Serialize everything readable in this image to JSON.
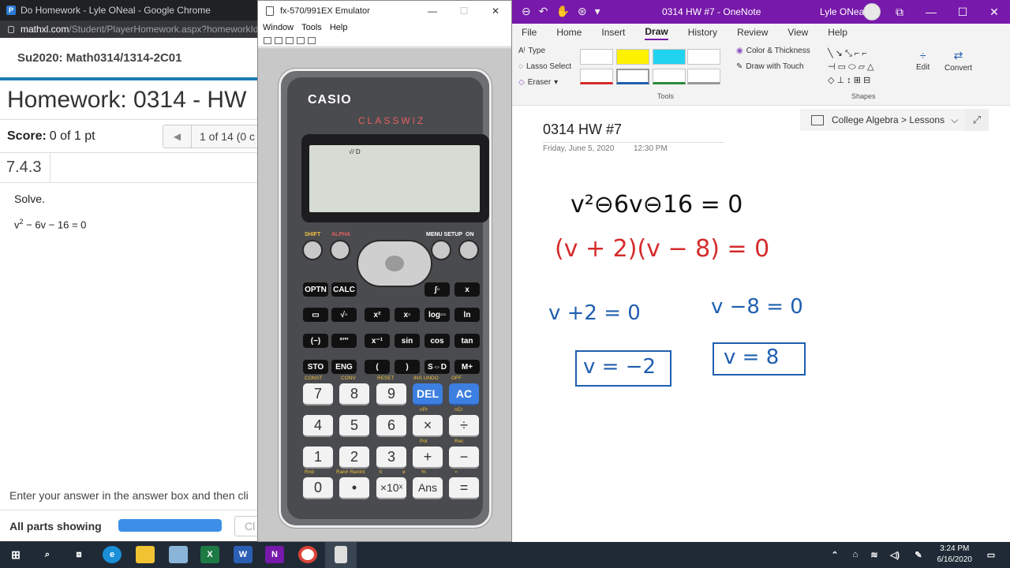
{
  "chrome": {
    "title": "Do Homework - Lyle ONeal - Google Chrome",
    "url_host": "mathxl.com",
    "url_path": "/Student/PlayerHomework.aspx?homeworkId",
    "course": "Su2020: Math0314/1314-2C01",
    "homework_title": "Homework: 0314 - HW",
    "score_label": "Score:",
    "score_value": "0 of 1 pt",
    "pager": "1 of 14 (0 c",
    "question_number": "7.4.3",
    "prompt": "Solve.",
    "equation_base": "v",
    "equation_exp": "2",
    "equation_rest": " − 6v − 16 = 0",
    "enter_text": "Enter your answer in the answer box and then cli",
    "all_parts": "All parts showing",
    "progress_fraction": 1.0,
    "clear_btn": "Cl"
  },
  "emulator": {
    "title": "fx-570/991EX Emulator",
    "menus": [
      "Window",
      "Tools",
      "Help"
    ],
    "brand": "CASIO",
    "model": "CLASSWIZ",
    "screen_indicator": "√/ D",
    "labels": {
      "shift": "SHIFT",
      "alpha": "ALPHA",
      "menu": "MENU SETUP",
      "on": "ON"
    },
    "func_keys": [
      "OPTN",
      "CALC",
      "∫▫",
      "x",
      "▭",
      "√▫",
      "x²",
      "x▫",
      "log▫▫",
      "ln",
      "(−)",
      "°′″",
      "x⁻¹",
      "sin",
      "cos",
      "tan",
      "STO",
      "ENG",
      "(",
      ")",
      "S⇔D",
      "M+"
    ],
    "num_keys": [
      "7",
      "8",
      "9",
      "DEL",
      "AC",
      "4",
      "5",
      "6",
      "×",
      "÷",
      "1",
      "2",
      "3",
      "+",
      "−",
      "0",
      "•",
      "×10ˣ",
      "Ans",
      "="
    ],
    "num_labels": [
      "CONST",
      "CONV",
      "RESET",
      "INS UNDO",
      "OFF",
      "nPr",
      "nCr",
      "Pol",
      "Rec",
      "Rnd",
      "Ran# RanInt",
      "π",
      "e",
      "%",
      "≈"
    ]
  },
  "onenote": {
    "window_title": "0314 HW #7  -  OneNote",
    "user": "Lyle ONeal",
    "tabs": [
      "File",
      "Home",
      "Insert",
      "Draw",
      "History",
      "Review",
      "View",
      "Help"
    ],
    "active_tab": "Draw",
    "type_label": "Type",
    "lasso_label": "Lasso Select",
    "eraser_label": "Eraser",
    "color_thickness": "Color & Thickness",
    "draw_touch": "Draw with Touch",
    "tools_group": "Tools",
    "shapes_group": "Shapes",
    "edit_label": "Edit",
    "convert_label": "Convert",
    "section": "College Algebra > Lessons",
    "page_title": "0314 HW #7",
    "page_date": "Friday, June 5, 2020",
    "page_time": "12:30 PM",
    "ink": {
      "line1": "v²⊖6v⊖16 = 0",
      "line2": "(v + 2)(v − 8) = 0",
      "line3a": "v +2 = 0",
      "line3b": "v −8 = 0",
      "answer1": "v = −2",
      "answer2": "v = 8"
    },
    "colors": {
      "brand": "#7719aa",
      "ink_black": "#111111",
      "ink_red": "#d42b2b",
      "ink_blue": "#1f5fb0"
    }
  },
  "taskbar": {
    "time": "3:24 PM",
    "date": "6/16/2020",
    "apps": [
      "start-icon",
      "search-icon",
      "task-view-icon",
      "edge-icon",
      "file-explorer-icon",
      "snip-icon",
      "excel-icon",
      "word-icon",
      "onenote-icon",
      "chrome-icon",
      "calculator-emulator-icon"
    ]
  }
}
